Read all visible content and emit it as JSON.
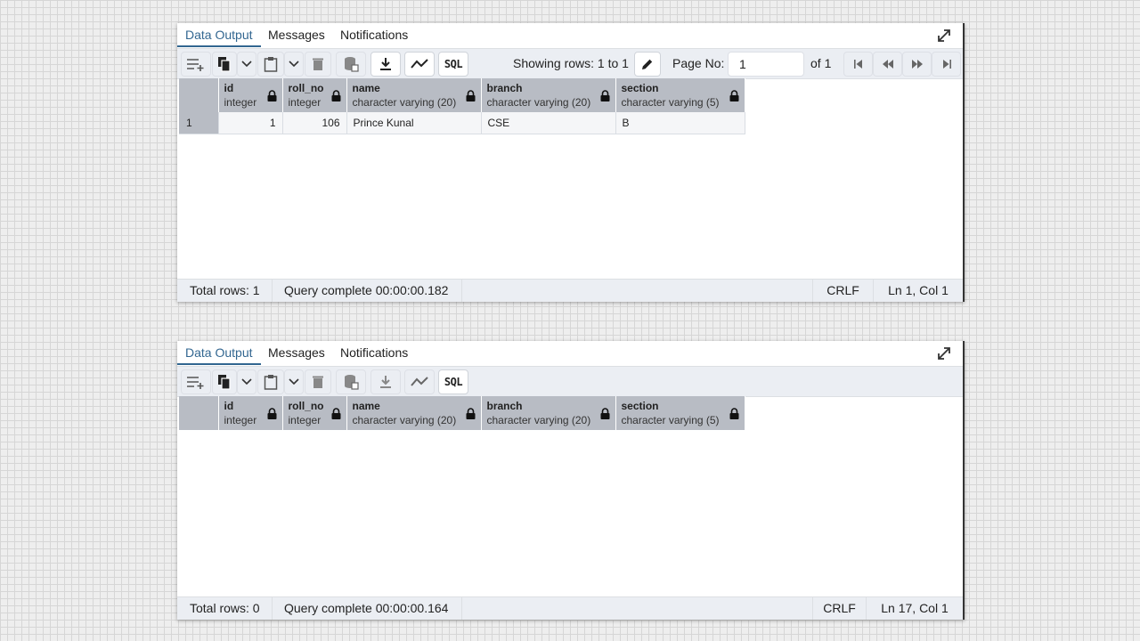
{
  "panels": [
    {
      "tabs": {
        "data_output": "Data Output",
        "messages": "Messages",
        "notifications": "Notifications"
      },
      "toolbar": {
        "sql_label": "SQL",
        "showing_rows": "Showing rows: 1 to 1",
        "page_no_label": "Page No:",
        "page_no_value": "1",
        "page_of": "of 1"
      },
      "columns": [
        {
          "name": "id",
          "type": "integer"
        },
        {
          "name": "roll_no",
          "type": "integer"
        },
        {
          "name": "name",
          "type": "character varying (20)"
        },
        {
          "name": "branch",
          "type": "character varying (20)"
        },
        {
          "name": "section",
          "type": "character varying (5)"
        }
      ],
      "rows": [
        {
          "rownum": "1",
          "id": "1",
          "roll_no": "106",
          "name": "Prince Kunal",
          "branch": "CSE",
          "section": "B"
        }
      ],
      "status": {
        "total_rows": "Total rows: 1",
        "query": "Query complete 00:00:00.182",
        "eol": "CRLF",
        "position": "Ln 1, Col 1"
      }
    },
    {
      "tabs": {
        "data_output": "Data Output",
        "messages": "Messages",
        "notifications": "Notifications"
      },
      "toolbar": {
        "sql_label": "SQL"
      },
      "columns": [
        {
          "name": "id",
          "type": "integer"
        },
        {
          "name": "roll_no",
          "type": "integer"
        },
        {
          "name": "name",
          "type": "character varying (20)"
        },
        {
          "name": "branch",
          "type": "character varying (20)"
        },
        {
          "name": "section",
          "type": "character varying (5)"
        }
      ],
      "rows": [],
      "status": {
        "total_rows": "Total rows: 0",
        "query": "Query complete 00:00:00.164",
        "eol": "CRLF",
        "position": "Ln 17, Col 1"
      }
    }
  ],
  "icons": {
    "expand": "expand-icon",
    "add_row": "add-row-icon",
    "copy": "copy-icon",
    "chevron": "chevron-down-icon",
    "paste": "paste-icon",
    "delete": "delete-icon",
    "save_data": "save-data-icon",
    "download": "download-icon",
    "graph": "graph-icon",
    "edit": "pencil-icon",
    "first_page": "first-page-icon",
    "prev_page": "previous-page-icon",
    "next_page": "next-page-icon",
    "last_page": "last-page-icon",
    "lock": "lock-icon"
  },
  "colors": {
    "accent": "#326690",
    "toolbar_bg": "#ebeef3",
    "header_bg": "#b8bcc4"
  }
}
